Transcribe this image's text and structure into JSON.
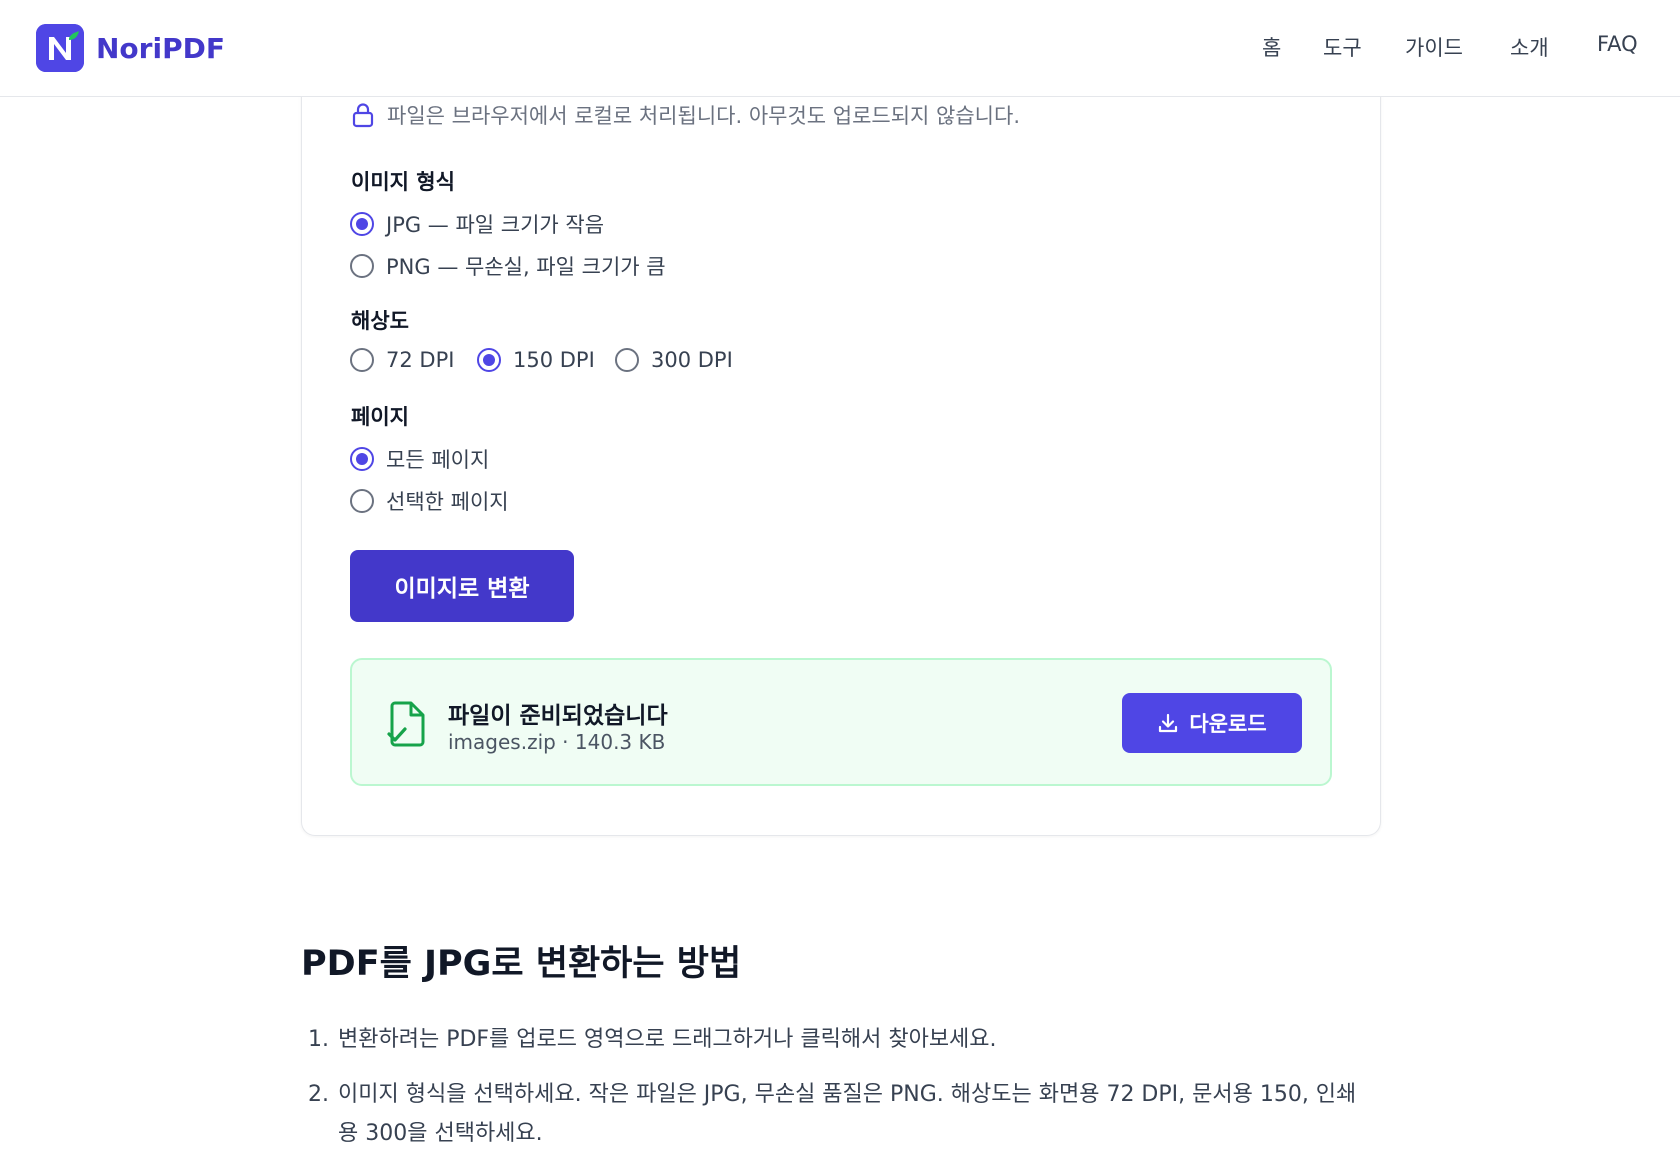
{
  "header": {
    "logo_text": "NoriPDF",
    "nav": [
      "홈",
      "도구",
      "가이드",
      "소개",
      "FAQ"
    ]
  },
  "privacy_note": "파일은 브라우저에서 로컬로 처리됩니다. 아무것도 업로드되지 않습니다.",
  "format": {
    "title": "이미지 형식",
    "options": [
      "JPG — 파일 크기가 작음",
      "PNG — 무손실, 파일 크기가 큼"
    ],
    "selected": 0
  },
  "resolution": {
    "title": "해상도",
    "options": [
      "72 DPI",
      "150 DPI",
      "300 DPI"
    ],
    "selected": 1
  },
  "pages": {
    "title": "페이지",
    "options": [
      "모든 페이지",
      "선택한 페이지"
    ],
    "selected": 0
  },
  "convert_button": "이미지로 변환",
  "result": {
    "title": "파일이 준비되었습니다",
    "meta": "images.zip · 140.3 KB",
    "download_label": "다운로드"
  },
  "howto": {
    "title": "PDF를 JPG로 변환하는 방법",
    "steps": [
      "변환하려는 PDF를 업로드 영역으로 드래그하거나 클릭해서 찾아보세요.",
      "이미지 형식을 선택하세요. 작은 파일은 JPG, 무손실 품질은 PNG. 해상도는 화면용 72 DPI, 문서용 150, 인쇄용 300을 선택하세요."
    ],
    "step_numbers": [
      "1.",
      "2."
    ]
  },
  "colors": {
    "accent": "#4f46e5",
    "accent_dark": "#4338ca",
    "success_bg": "#f0fdf4",
    "success_border": "#bbf7d0",
    "success_icon": "#16a34a"
  }
}
